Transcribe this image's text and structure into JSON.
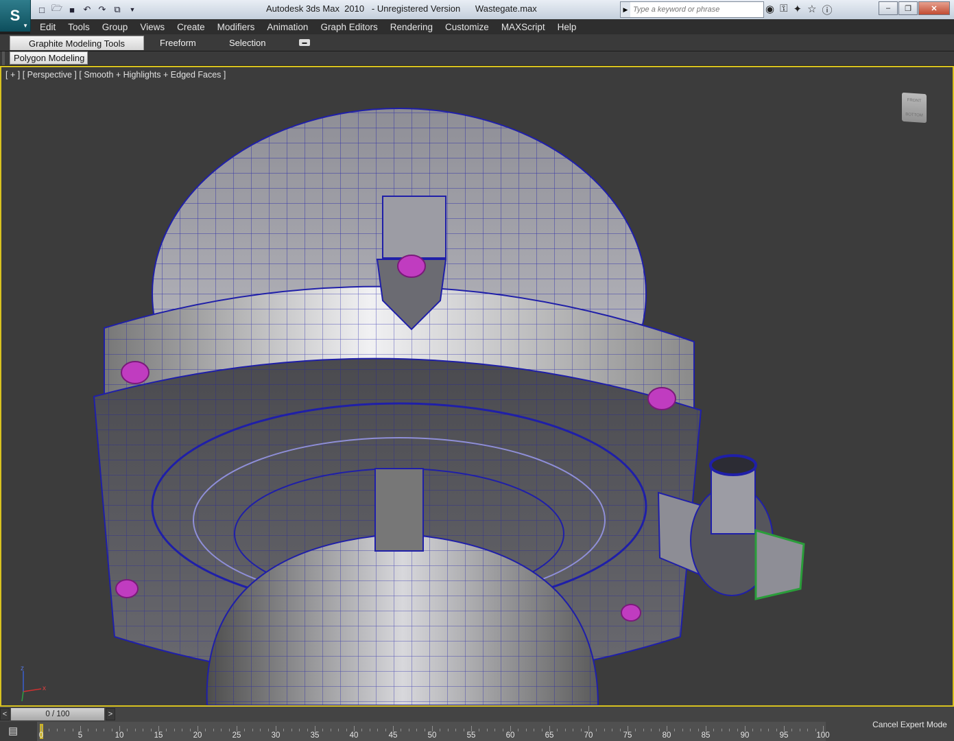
{
  "titlebar": {
    "title": "Autodesk 3ds Max  2010   - Unregistered Version      Wastegate.max",
    "search_placeholder": "Type a keyword or phrase",
    "quick_access_icons": [
      "new-file-icon",
      "open-file-icon",
      "save-icon",
      "undo-icon",
      "redo-icon",
      "project-folder-icon",
      "dropdown-icon"
    ],
    "help_icons": [
      "binoculars-icon",
      "key-icon",
      "star-tool-icon",
      "favorites-icon",
      "help-icon"
    ]
  },
  "menu": {
    "items": [
      "Edit",
      "Tools",
      "Group",
      "Views",
      "Create",
      "Modifiers",
      "Animation",
      "Graph Editors",
      "Rendering",
      "Customize",
      "MAXScript",
      "Help"
    ]
  },
  "ribbon": {
    "tabs": [
      "Graphite Modeling Tools",
      "Freeform",
      "Selection"
    ],
    "panel": "Polygon Modeling"
  },
  "viewport": {
    "label_plus": "[ + ]",
    "label_view": "[ Perspective ]",
    "label_shading": "[ Smooth + Highlights + Edged Faces ]",
    "viewcube_top": "FRONT",
    "viewcube_bottom": "BOTTOM",
    "axis_z": "z",
    "axis_x": "x",
    "colors": {
      "wireframe": "#1f1fa8",
      "bolt": "#c03cc0",
      "fitting": "#2a9d3a",
      "active_border": "#d8c21f"
    }
  },
  "timeline": {
    "frame_readout": "0 / 100",
    "prev": "<",
    "next": ">",
    "ticks": [
      "0",
      "5",
      "10",
      "15",
      "20",
      "25",
      "30",
      "35",
      "40",
      "45",
      "50",
      "55",
      "60",
      "65",
      "70",
      "75",
      "80",
      "85",
      "90",
      "95",
      "100"
    ],
    "current_frame": 0,
    "cancel_expert": "Cancel Expert Mode"
  }
}
